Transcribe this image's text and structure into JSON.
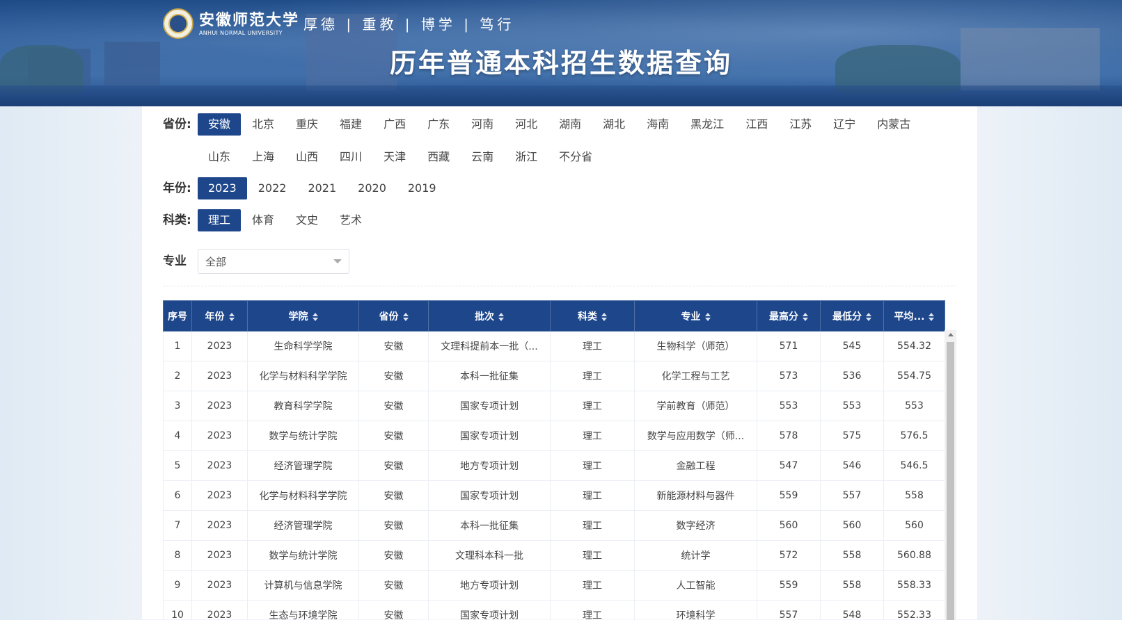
{
  "header": {
    "logo_cn": "安徽师范大学",
    "logo_en": "ANHUI NORMAL UNIVERSITY",
    "motto": "厚德 | 重教 | 博学 | 笃行",
    "title": "历年普通本科招生数据查询"
  },
  "filters": {
    "province": {
      "label": "省份:",
      "selected": "安徽",
      "options": [
        "安徽",
        "北京",
        "重庆",
        "福建",
        "广西",
        "广东",
        "河南",
        "河北",
        "湖南",
        "湖北",
        "海南",
        "黑龙江",
        "江西",
        "江苏",
        "辽宁",
        "内蒙古",
        "山东",
        "上海",
        "山西",
        "四川",
        "天津",
        "西藏",
        "云南",
        "浙江",
        "不分省"
      ]
    },
    "year": {
      "label": "年份:",
      "selected": "2023",
      "options": [
        "2023",
        "2022",
        "2021",
        "2020",
        "2019"
      ]
    },
    "category": {
      "label": "科类:",
      "selected": "理工",
      "options": [
        "理工",
        "体育",
        "文史",
        "艺术"
      ]
    },
    "major": {
      "label": "专业",
      "value": "全部"
    }
  },
  "table": {
    "columns": [
      "序号",
      "年份",
      "学院",
      "省份",
      "批次",
      "科类",
      "专业",
      "最高分",
      "最低分",
      "平均..."
    ],
    "rows": [
      [
        "1",
        "2023",
        "生命科学学院",
        "安徽",
        "文理科提前本一批（...",
        "理工",
        "生物科学（师范）",
        "571",
        "545",
        "554.32"
      ],
      [
        "2",
        "2023",
        "化学与材料科学学院",
        "安徽",
        "本科一批征集",
        "理工",
        "化学工程与工艺",
        "573",
        "536",
        "554.75"
      ],
      [
        "3",
        "2023",
        "教育科学学院",
        "安徽",
        "国家专项计划",
        "理工",
        "学前教育（师范）",
        "553",
        "553",
        "553"
      ],
      [
        "4",
        "2023",
        "数学与统计学院",
        "安徽",
        "国家专项计划",
        "理工",
        "数学与应用数学（师...",
        "578",
        "575",
        "576.5"
      ],
      [
        "5",
        "2023",
        "经济管理学院",
        "安徽",
        "地方专项计划",
        "理工",
        "金融工程",
        "547",
        "546",
        "546.5"
      ],
      [
        "6",
        "2023",
        "化学与材料科学学院",
        "安徽",
        "国家专项计划",
        "理工",
        "新能源材料与器件",
        "559",
        "557",
        "558"
      ],
      [
        "7",
        "2023",
        "经济管理学院",
        "安徽",
        "本科一批征集",
        "理工",
        "数字经济",
        "560",
        "560",
        "560"
      ],
      [
        "8",
        "2023",
        "数学与统计学院",
        "安徽",
        "文理科本科一批",
        "理工",
        "统计学",
        "572",
        "558",
        "560.88"
      ],
      [
        "9",
        "2023",
        "计算机与信息学院",
        "安徽",
        "地方专项计划",
        "理工",
        "人工智能",
        "559",
        "558",
        "558.33"
      ],
      [
        "10",
        "2023",
        "生态与环境学院",
        "安徽",
        "国家专项计划",
        "理工",
        "环境科学",
        "557",
        "548",
        "552.33"
      ]
    ]
  }
}
